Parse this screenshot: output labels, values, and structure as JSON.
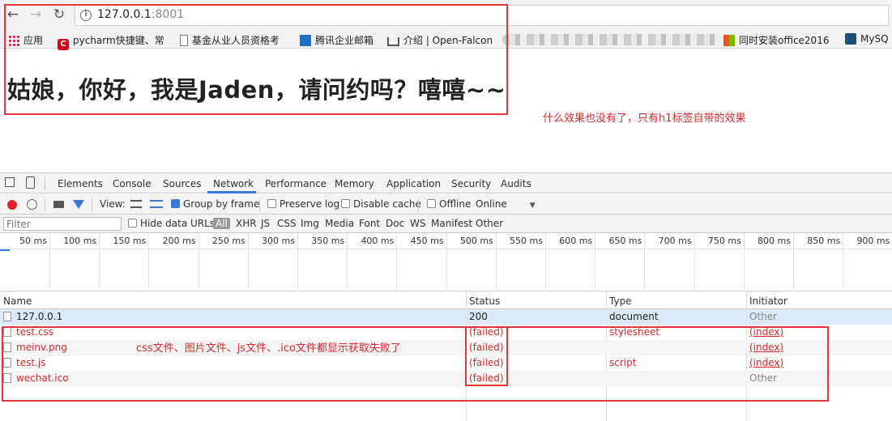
{
  "browser": {
    "back_icon": "arrow-left-icon",
    "forward_icon": "arrow-right-icon",
    "reload_icon": "reload-icon",
    "url_host": "127.0.0.1",
    "url_port": ":8001",
    "bookmarks": [
      {
        "label": "应用",
        "icon": "apps-grid-icon"
      },
      {
        "label": "pycharm快捷键、常",
        "icon": "pycharm-icon"
      },
      {
        "label": "基金从业人员资格考",
        "icon": "page-icon"
      },
      {
        "label": "腾讯企业邮箱",
        "icon": "tencent-mail-icon"
      },
      {
        "label": "介绍 | Open-Falcon",
        "icon": "book-icon"
      },
      {
        "label": "同时安装office2016",
        "icon": "windows-icon"
      },
      {
        "label": "MySQ",
        "icon": "mysql-icon"
      }
    ]
  },
  "page": {
    "heading": "姑娘，你好，我是Jaden，请问约吗？嘻嘻~~"
  },
  "annotations": {
    "note_top": "什么效果也没有了，只有h1标签自带的效果",
    "note_table": "css文件、图片文件、js文件、.ico文件都显示获取失败了",
    "box_color": "#e0363c"
  },
  "devtools": {
    "tabs": [
      "Elements",
      "Console",
      "Sources",
      "Network",
      "Performance",
      "Memory",
      "Application",
      "Security",
      "Audits"
    ],
    "active_tab": "Network",
    "controls": {
      "view_label": "View:",
      "group_by_frame": "Group by frame",
      "preserve_log": "Preserve log",
      "disable_cache": "Disable cache",
      "offline": "Offline",
      "throttle": "Online"
    },
    "filter": {
      "placeholder": "Filter",
      "hide_data_urls": "Hide data URLs",
      "types": [
        "All",
        "XHR",
        "JS",
        "CSS",
        "Img",
        "Media",
        "Font",
        "Doc",
        "WS",
        "Manifest",
        "Other"
      ]
    },
    "timeline_ticks": [
      "50 ms",
      "100 ms",
      "150 ms",
      "200 ms",
      "250 ms",
      "300 ms",
      "350 ms",
      "400 ms",
      "450 ms",
      "500 ms",
      "550 ms",
      "600 ms",
      "650 ms",
      "700 ms",
      "750 ms",
      "800 ms",
      "850 ms",
      "900 ms"
    ],
    "columns": [
      "Name",
      "Status",
      "Type",
      "Initiator"
    ],
    "rows": [
      {
        "name": "127.0.0.1",
        "status": "200",
        "type": "document",
        "initiator": "Other",
        "failed": false
      },
      {
        "name": "test.css",
        "status": "(failed)",
        "type": "stylesheet",
        "initiator": "(index)",
        "failed": true
      },
      {
        "name": "meinv.png",
        "status": "(failed)",
        "type": "",
        "initiator": "(index)",
        "failed": true
      },
      {
        "name": "test.js",
        "status": "(failed)",
        "type": "script",
        "initiator": "(index)",
        "failed": true
      },
      {
        "name": "wechat.ico",
        "status": "(failed)",
        "type": "",
        "initiator": "Other",
        "failed": true
      }
    ]
  }
}
